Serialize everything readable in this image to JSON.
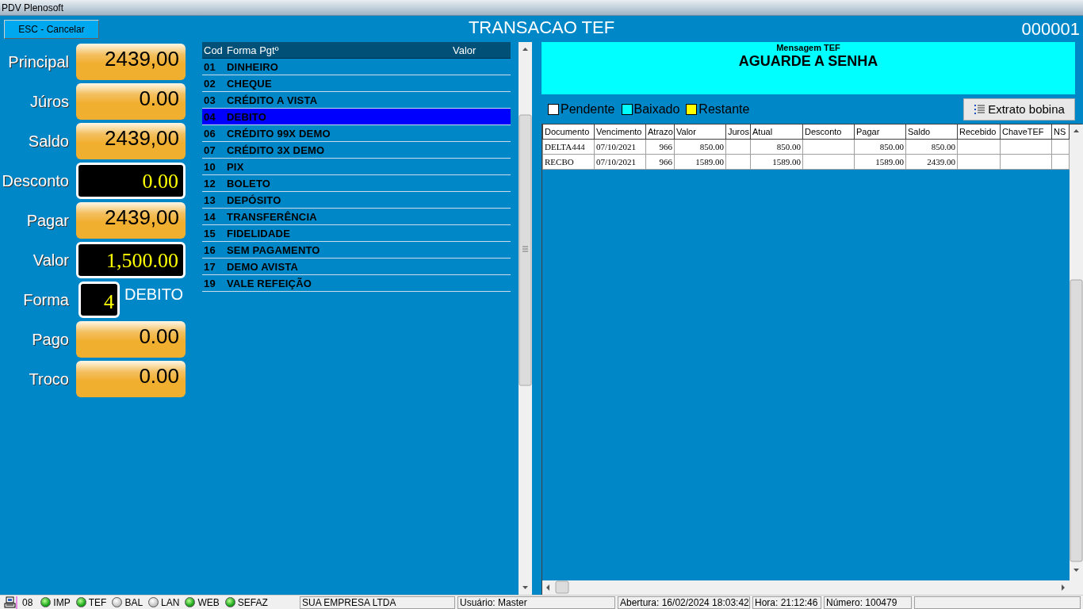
{
  "window": {
    "title": "PDV Plenosoft"
  },
  "header": {
    "cancel_button": "ESC - Cancelar",
    "title": "TRANSACAO TEF",
    "number": "000001"
  },
  "fields": [
    {
      "label": "Principal",
      "value": "2439,00",
      "kind": "display"
    },
    {
      "label": "Júros",
      "value": "0.00",
      "kind": "display"
    },
    {
      "label": "Saldo",
      "value": "2439,00",
      "kind": "display"
    },
    {
      "label": "Desconto",
      "value": "0.00",
      "kind": "input"
    },
    {
      "label": "Pagar",
      "value": "2439,00",
      "kind": "display"
    },
    {
      "label": "Valor",
      "value": "1,500.00",
      "kind": "input"
    },
    {
      "label": "Forma",
      "value": "4",
      "kind": "code",
      "description": "DEBITO"
    },
    {
      "label": "Pago",
      "value": "0.00",
      "kind": "display"
    },
    {
      "label": "Troco",
      "value": "0.00",
      "kind": "display"
    }
  ],
  "payment_list": {
    "columns": [
      "Cod",
      "Forma Pgtº",
      "Valor"
    ],
    "rows": [
      {
        "code": "01",
        "name": "DINHEIRO",
        "selected": false
      },
      {
        "code": "02",
        "name": "CHEQUE",
        "selected": false
      },
      {
        "code": "03",
        "name": "CRÉDITO A VISTA",
        "selected": false
      },
      {
        "code": "04",
        "name": "DEBITO",
        "selected": true
      },
      {
        "code": "06",
        "name": "CRÉDITO 99X DEMO",
        "selected": false
      },
      {
        "code": "07",
        "name": "CRÉDITO 3X DEMO",
        "selected": false
      },
      {
        "code": "10",
        "name": "PIX",
        "selected": false
      },
      {
        "code": "12",
        "name": "BOLETO",
        "selected": false
      },
      {
        "code": "13",
        "name": "DEPÓSITO",
        "selected": false
      },
      {
        "code": "14",
        "name": "TRANSFERÊNCIA",
        "selected": false
      },
      {
        "code": "15",
        "name": "FIDELIDADE",
        "selected": false
      },
      {
        "code": "16",
        "name": "SEM PAGAMENTO",
        "selected": false
      },
      {
        "code": "17",
        "name": "DEMO AVISTA",
        "selected": false
      },
      {
        "code": "19",
        "name": "VALE REFEIÇÃO",
        "selected": false
      }
    ]
  },
  "message": {
    "caption": "Mensagem TEF",
    "text": "AGUARDE A SENHA"
  },
  "legend": [
    {
      "label": "Pendente",
      "color": "#ffffff"
    },
    {
      "label": "Baixado",
      "color": "#00ffff"
    },
    {
      "label": "Restante",
      "color": "#ffff00"
    }
  ],
  "statement_button": "Extrato bobina",
  "table": {
    "columns": [
      "Documento",
      "Vencimento",
      "Atrazo",
      "Valor",
      "Juros",
      "Atual",
      "Desconto",
      "Pagar",
      "Saldo",
      "Recebido",
      "ChaveTEF",
      "NS"
    ],
    "rows": [
      [
        "DELTA444",
        "07/10/2021",
        "966",
        "850.00",
        null,
        "850.00",
        null,
        "850.00",
        "850.00",
        null,
        null,
        null
      ],
      [
        "RECBO",
        "07/10/2021",
        "966",
        "1589.00",
        null,
        "1589.00",
        null,
        "1589.00",
        "2439.00",
        null,
        null,
        null
      ]
    ]
  },
  "status_bar": {
    "terminal": "08",
    "indicators": [
      {
        "label": "IMP",
        "on": true
      },
      {
        "label": "TEF",
        "on": true
      },
      {
        "label": "BAL",
        "on": false
      },
      {
        "label": "LAN",
        "on": false
      },
      {
        "label": "WEB",
        "on": true
      },
      {
        "label": "SEFAZ",
        "on": true
      }
    ],
    "company": "SUA EMPRESA LTDA",
    "user": "Usuário: Master",
    "opened": "Abertura: 16/02/2024 18:03:42",
    "time": "Hora: 21:12:46",
    "number": "Número: 100479"
  }
}
